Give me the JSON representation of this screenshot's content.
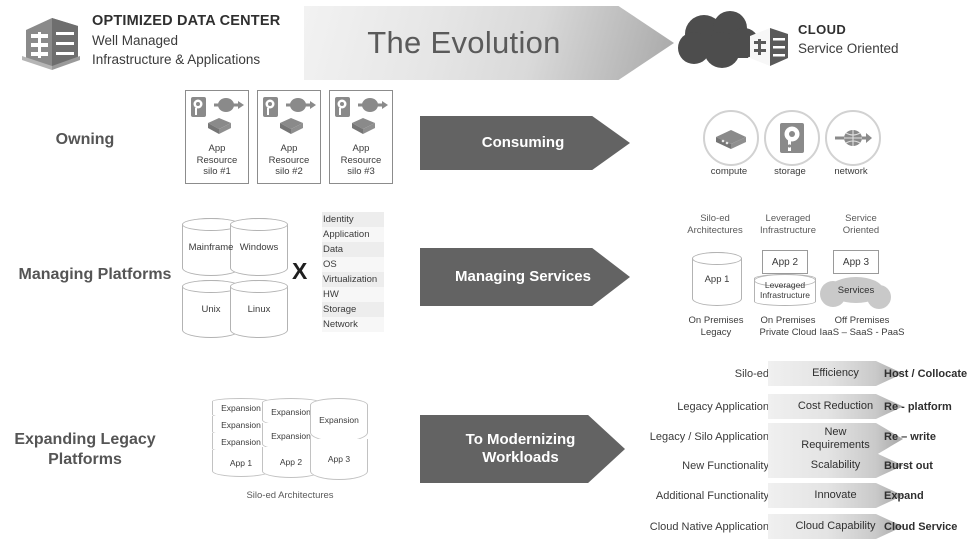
{
  "header": {
    "left": {
      "icon": "datacenter-building-icon",
      "title": "OPTIMIZED DATA CENTER",
      "line2": "Well Managed",
      "line3": "Infrastructure & Applications"
    },
    "banner_title": "The Evolution",
    "right": {
      "icon": "cloud-datacenter-icon",
      "title": "CLOUD",
      "subtitle": "Service Oriented"
    }
  },
  "rows": {
    "owning": "Owning",
    "managing_platforms": "Managing Platforms",
    "expanding_legacy": "Expanding Legacy\nPlatforms",
    "expanding_legacy_l1": "Expanding Legacy",
    "expanding_legacy_l2": "Platforms"
  },
  "arrows": {
    "consuming": "Consuming",
    "managing_services": "Managing Services",
    "to_modernizing_l1": "To Modernizing",
    "to_modernizing_l2": "Workloads"
  },
  "silos": [
    {
      "l1": "App",
      "l2": "Resource",
      "l3": "silo #1"
    },
    {
      "l1": "App",
      "l2": "Resource",
      "l3": "silo #2"
    },
    {
      "l1": "App",
      "l2": "Resource",
      "l3": "silo #3"
    }
  ],
  "platforms": [
    "Mainframe",
    "Windows",
    "Unix",
    "Linux"
  ],
  "x_separator": "X",
  "stack": [
    "Identity",
    "Application",
    "Data",
    "OS",
    "Virtualization",
    "HW",
    "Storage",
    "Network"
  ],
  "cloud_services": [
    {
      "label": "compute",
      "icon": "server-compute-icon"
    },
    {
      "label": "storage",
      "icon": "hard-disk-icon"
    },
    {
      "label": "network",
      "icon": "network-globe-icon"
    }
  ],
  "architectures": [
    {
      "head_l1": "Silo-ed",
      "head_l2": "Architectures",
      "app": "App 1",
      "foot_l1": "On Premises",
      "foot_l2": "Legacy"
    },
    {
      "head_l1": "Leveraged",
      "head_l2": "Infrastructure",
      "app": "App 2",
      "sub_l1": "Leveraged",
      "sub_l2": "Infrastructure",
      "foot_l1": "On Premises",
      "foot_l2": "Private Cloud"
    },
    {
      "head_l1": "Service",
      "head_l2": "Oriented",
      "app": "App 3",
      "sub_l1": "Services",
      "foot_l1": "Off Premises",
      "foot_l2": "IaaS – SaaS - PaaS"
    }
  ],
  "expansion": {
    "columns": [
      {
        "segments": [
          "Expansion",
          "Expansion",
          "Expansion"
        ],
        "app": "App 1"
      },
      {
        "segments": [
          "Expansion",
          "Expansion"
        ],
        "app": "App 2"
      },
      {
        "segments": [
          "Expansion"
        ],
        "app": "App 3"
      }
    ],
    "caption": "Silo-ed Architectures"
  },
  "modernize_table": [
    {
      "left": "Silo-ed",
      "middle_l1": "Efficiency",
      "middle_l2": "",
      "right": "Host / Collocate"
    },
    {
      "left": "Legacy Application",
      "middle_l1": "Cost Reduction",
      "middle_l2": "",
      "right": "Re - platform"
    },
    {
      "left": "Legacy / Silo Application",
      "middle_l1": "New",
      "middle_l2": "Requirements",
      "right": "Re – write"
    },
    {
      "left": "New Functionality",
      "middle_l1": "Scalability",
      "middle_l2": "",
      "right": "Burst out"
    },
    {
      "left": "Additional Functionality",
      "middle_l1": "Innovate",
      "middle_l2": "",
      "right": "Expand"
    },
    {
      "left": "Cloud Native Application",
      "middle_l1": "Cloud Capability",
      "middle_l2": "",
      "right": "Cloud Service"
    }
  ],
  "colors": {
    "dark_arrow": "#636363",
    "icon_gray": "#808080",
    "text_gray": "#3b3b3b",
    "label_gray": "#555555"
  }
}
